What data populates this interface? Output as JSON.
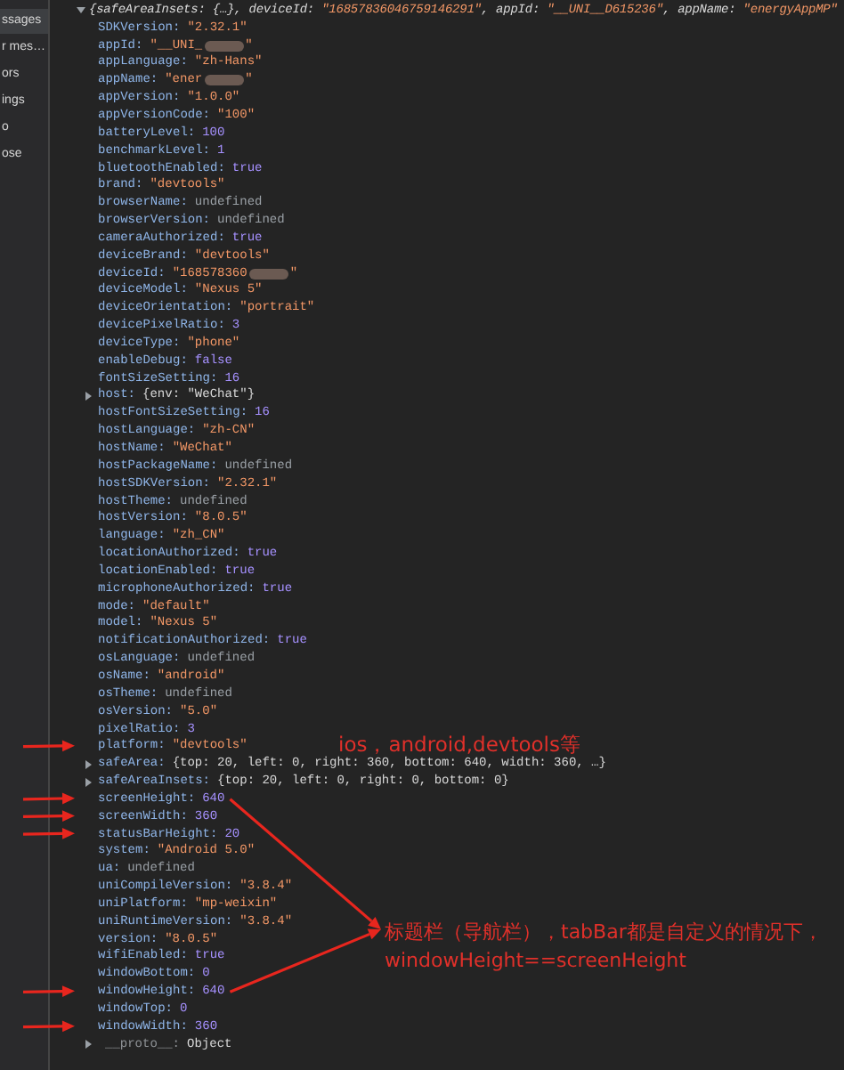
{
  "sidebar": {
    "items": [
      {
        "label": "ssages",
        "selected": true
      },
      {
        "label": "r mes…",
        "selected": false
      },
      {
        "label": "ors",
        "selected": false
      },
      {
        "label": "ings",
        "selected": false
      },
      {
        "label": "o",
        "selected": false
      },
      {
        "label": "ose",
        "selected": false
      }
    ]
  },
  "console": {
    "summary": {
      "expanded": true,
      "segments": [
        {
          "text": "{safeAreaInsets: {…}, deviceId: ",
          "kind": "key"
        },
        {
          "text": "\"16857836046759146291\"",
          "kind": "string"
        },
        {
          "text": ", appId: ",
          "kind": "key"
        },
        {
          "text": "\"__UNI__D615236\"",
          "kind": "string"
        },
        {
          "text": ", appName: ",
          "kind": "key"
        },
        {
          "text": "\"energyAppMP\"",
          "kind": "string"
        }
      ]
    },
    "properties": [
      {
        "key": "SDKVersion:",
        "value": "\"2.32.1\"",
        "kind": "string"
      },
      {
        "key": "appId:",
        "value": "\"__UNI_",
        "kind": "string",
        "redacted": true,
        "value_end": "\""
      },
      {
        "key": "appLanguage:",
        "value": "\"zh-Hans\"",
        "kind": "string"
      },
      {
        "key": "appName:",
        "value": "\"ener",
        "kind": "string",
        "redacted": true,
        "value_end": "\""
      },
      {
        "key": "appVersion:",
        "value": "\"1.0.0\"",
        "kind": "string"
      },
      {
        "key": "appVersionCode:",
        "value": "\"100\"",
        "kind": "string"
      },
      {
        "key": "batteryLevel:",
        "value": "100",
        "kind": "number"
      },
      {
        "key": "benchmarkLevel:",
        "value": "1",
        "kind": "number"
      },
      {
        "key": "bluetoothEnabled:",
        "value": "true",
        "kind": "boolean"
      },
      {
        "key": "brand:",
        "value": "\"devtools\"",
        "kind": "string"
      },
      {
        "key": "browserName:",
        "value": "undefined",
        "kind": "undefined"
      },
      {
        "key": "browserVersion:",
        "value": "undefined",
        "kind": "undefined"
      },
      {
        "key": "cameraAuthorized:",
        "value": "true",
        "kind": "boolean"
      },
      {
        "key": "deviceBrand:",
        "value": "\"devtools\"",
        "kind": "string"
      },
      {
        "key": "deviceId:",
        "value": "\"168578360",
        "kind": "string",
        "redacted": true,
        "value_end": "\""
      },
      {
        "key": "deviceModel:",
        "value": "\"Nexus 5\"",
        "kind": "string"
      },
      {
        "key": "deviceOrientation:",
        "value": "\"portrait\"",
        "kind": "string"
      },
      {
        "key": "devicePixelRatio:",
        "value": "3",
        "kind": "number"
      },
      {
        "key": "deviceType:",
        "value": "\"phone\"",
        "kind": "string"
      },
      {
        "key": "enableDebug:",
        "value": "false",
        "kind": "boolean"
      },
      {
        "key": "fontSizeSetting:",
        "value": "16",
        "kind": "number"
      },
      {
        "key": "host:",
        "value": "{env: \"WeChat\"}",
        "kind": "object",
        "expanded": false
      },
      {
        "key": "hostFontSizeSetting:",
        "value": "16",
        "kind": "number"
      },
      {
        "key": "hostLanguage:",
        "value": "\"zh-CN\"",
        "kind": "string"
      },
      {
        "key": "hostName:",
        "value": "\"WeChat\"",
        "kind": "string"
      },
      {
        "key": "hostPackageName:",
        "value": "undefined",
        "kind": "undefined"
      },
      {
        "key": "hostSDKVersion:",
        "value": "\"2.32.1\"",
        "kind": "string"
      },
      {
        "key": "hostTheme:",
        "value": "undefined",
        "kind": "undefined"
      },
      {
        "key": "hostVersion:",
        "value": "\"8.0.5\"",
        "kind": "string"
      },
      {
        "key": "language:",
        "value": "\"zh_CN\"",
        "kind": "string"
      },
      {
        "key": "locationAuthorized:",
        "value": "true",
        "kind": "boolean"
      },
      {
        "key": "locationEnabled:",
        "value": "true",
        "kind": "boolean"
      },
      {
        "key": "microphoneAuthorized:",
        "value": "true",
        "kind": "boolean"
      },
      {
        "key": "mode:",
        "value": "\"default\"",
        "kind": "string"
      },
      {
        "key": "model:",
        "value": "\"Nexus 5\"",
        "kind": "string"
      },
      {
        "key": "notificationAuthorized:",
        "value": "true",
        "kind": "boolean"
      },
      {
        "key": "osLanguage:",
        "value": "undefined",
        "kind": "undefined"
      },
      {
        "key": "osName:",
        "value": "\"android\"",
        "kind": "string"
      },
      {
        "key": "osTheme:",
        "value": "undefined",
        "kind": "undefined"
      },
      {
        "key": "osVersion:",
        "value": "\"5.0\"",
        "kind": "string"
      },
      {
        "key": "pixelRatio:",
        "value": "3",
        "kind": "number"
      },
      {
        "key": "platform:",
        "value": "\"devtools\"",
        "kind": "string",
        "marked": true
      },
      {
        "key": "safeArea:",
        "value": "{top: 20, left: 0, right: 360, bottom: 640, width: 360, …}",
        "kind": "object",
        "expanded": false
      },
      {
        "key": "safeAreaInsets:",
        "value": "{top: 20, left: 0, right: 0, bottom: 0}",
        "kind": "object",
        "expanded": false
      },
      {
        "key": "screenHeight:",
        "value": "640",
        "kind": "number",
        "marked": true,
        "callout": true
      },
      {
        "key": "screenWidth:",
        "value": "360",
        "kind": "number",
        "marked": true
      },
      {
        "key": "statusBarHeight:",
        "value": "20",
        "kind": "number",
        "marked": true
      },
      {
        "key": "system:",
        "value": "\"Android 5.0\"",
        "kind": "string"
      },
      {
        "key": "ua:",
        "value": "undefined",
        "kind": "undefined"
      },
      {
        "key": "uniCompileVersion:",
        "value": "\"3.8.4\"",
        "kind": "string"
      },
      {
        "key": "uniPlatform:",
        "value": "\"mp-weixin\"",
        "kind": "string"
      },
      {
        "key": "uniRuntimeVersion:",
        "value": "\"3.8.4\"",
        "kind": "string"
      },
      {
        "key": "version:",
        "value": "\"8.0.5\"",
        "kind": "string"
      },
      {
        "key": "wifiEnabled:",
        "value": "true",
        "kind": "boolean"
      },
      {
        "key": "windowBottom:",
        "value": "0",
        "kind": "number"
      },
      {
        "key": "windowHeight:",
        "value": "640",
        "kind": "number",
        "marked": true,
        "callout": true
      },
      {
        "key": "windowTop:",
        "value": "0",
        "kind": "number"
      },
      {
        "key": "windowWidth:",
        "value": "360",
        "kind": "number",
        "marked": true
      },
      {
        "key": "__proto__:",
        "value": "Object",
        "kind": "proto",
        "expanded": false
      }
    ]
  },
  "annotations": [
    {
      "text": "ios，android,devtools等",
      "kind": "platform-note"
    },
    {
      "text": "标题栏（导航栏），tabBar都是自定义的情况下，",
      "kind": "height-note"
    },
    {
      "text": "windowHeight==screenHeight",
      "kind": "height-formula"
    }
  ]
}
